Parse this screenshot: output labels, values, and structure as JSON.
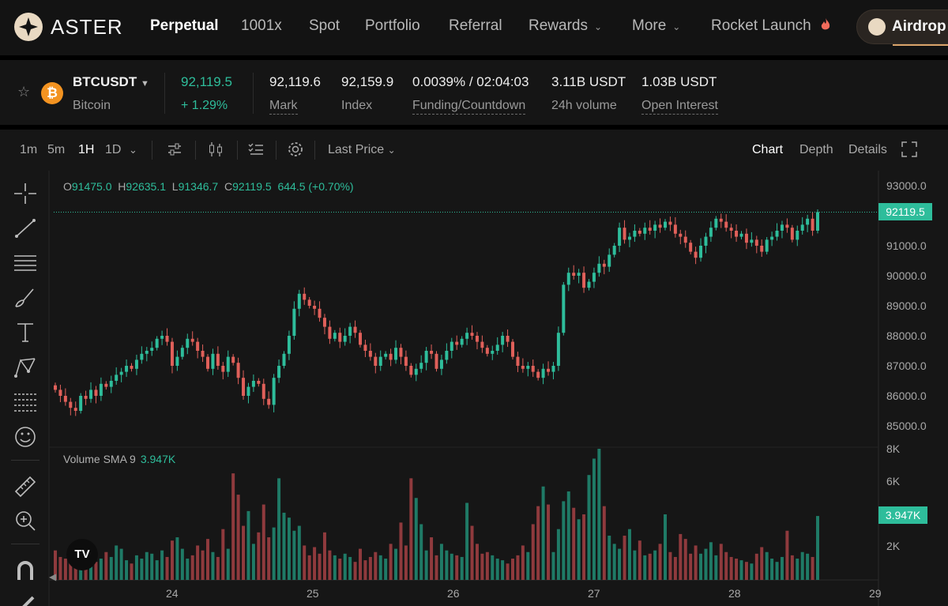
{
  "nav": {
    "brand": "ASTER",
    "items": [
      {
        "label": "Perpetual",
        "active": true
      },
      {
        "label": "1001x"
      },
      {
        "label": "Spot"
      },
      {
        "label": "Portfolio"
      },
      {
        "label": "Referral"
      },
      {
        "label": "Rewards",
        "dropdown": true
      },
      {
        "label": "More",
        "dropdown": true
      },
      {
        "label": "Rocket Launch",
        "icon": "flame-icon"
      }
    ],
    "airdrop": "Airdrop"
  },
  "ticker": {
    "symbol": "BTCUSDT",
    "name": "Bitcoin",
    "last_price": "92,119.5",
    "change": "+ 1.29%",
    "mark": "92,119.6",
    "mark_label": "Mark",
    "index": "92,159.9",
    "index_label": "Index",
    "funding": "0.0039% / 02:04:03",
    "funding_label": "Funding/Countdown",
    "volume": "3.11B USDT",
    "volume_label": "24h volume",
    "open_interest": "1.03B USDT",
    "open_interest_label": "Open Interest"
  },
  "toolbar": {
    "intervals": [
      "1m",
      "5m",
      "1H",
      "1D"
    ],
    "active_interval": "1H",
    "price_type": "Last Price",
    "views": [
      "Chart",
      "Depth",
      "Details"
    ],
    "active_view": "Chart"
  },
  "left_tools": [
    "crosshair-icon",
    "trendline-icon",
    "horizontal-lines-icon",
    "brush-icon",
    "text-icon",
    "pattern-icon",
    "fib-icon",
    "emoji-icon",
    "ruler-icon",
    "zoom-in-icon",
    "magnet-icon",
    "pencil-icon"
  ],
  "ohlc": {
    "o_key": "O",
    "o": "91475.0",
    "h_key": "H",
    "h": "92635.1",
    "l_key": "L",
    "l": "91346.7",
    "c_key": "C",
    "c": "92119.5",
    "chg": "644.5 (+0.70%)"
  },
  "volume_indicator": {
    "label": "Volume SMA 9",
    "value": "3.947K"
  },
  "price_axis": [
    "93000.0",
    "92000.0",
    "91000.0",
    "90000.0",
    "89000.0",
    "88000.0",
    "87000.0",
    "86000.0",
    "85000.0"
  ],
  "volume_axis": [
    "8K",
    "6K",
    "4K",
    "2K"
  ],
  "current_price_tag": "92119.5",
  "volume_tag": "3.947K",
  "time_axis": [
    "24",
    "25",
    "26",
    "27",
    "28",
    "29"
  ],
  "colors": {
    "up": "#2ebd9b",
    "down": "#e0605a",
    "up_vol": "#1f7a66",
    "down_vol": "#8f3a3d"
  },
  "chart_data": {
    "type": "candlestick",
    "interval": "1H",
    "ylim": [
      84500,
      93500
    ],
    "closes": [
      86200,
      86000,
      85800,
      85600,
      85500,
      86000,
      85900,
      86200,
      86000,
      86400,
      86300,
      86500,
      86700,
      86800,
      87000,
      86900,
      87200,
      87400,
      87500,
      87600,
      87900,
      88000,
      87800,
      87000,
      87300,
      87600,
      87900,
      87800,
      87500,
      87300,
      86900,
      87400,
      87000,
      86800,
      87300,
      87100,
      86600,
      86000,
      86300,
      86500,
      86400,
      85900,
      85700,
      86600,
      87000,
      87400,
      88000,
      88900,
      89400,
      89200,
      89000,
      88900,
      88600,
      88300,
      87900,
      88100,
      87800,
      88000,
      88300,
      88100,
      87700,
      87500,
      87300,
      87000,
      87300,
      87400,
      87200,
      87600,
      87300,
      87000,
      86700,
      86900,
      87100,
      87500,
      87400,
      86900,
      87200,
      87500,
      87800,
      87700,
      87900,
      88100,
      88000,
      87800,
      87600,
      87400,
      87500,
      87700,
      88000,
      87800,
      87300,
      87000,
      86900,
      87000,
      86800,
      86600,
      86900,
      86800,
      87000,
      88100,
      89700,
      90100,
      90000,
      90100,
      89600,
      89800,
      90100,
      90400,
      90300,
      90700,
      91000,
      91600,
      91200,
      91300,
      91500,
      91400,
      91600,
      91500,
      91700,
      91600,
      91800,
      91700,
      91400,
      91300,
      91100,
      90800,
      90600,
      91000,
      91300,
      91600,
      91900,
      91800,
      91600,
      91500,
      91300,
      91400,
      91100,
      91200,
      91000,
      90800,
      91200,
      91300,
      91500,
      91700,
      91600,
      91200,
      91500,
      91700,
      91900,
      91500,
      92119.5
    ],
    "volume_range": [
      0,
      8000
    ],
    "volumes": [
      1800,
      1400,
      1300,
      1500,
      1200,
      1000,
      1600,
      1500,
      1100,
      1300,
      1700,
      1400,
      2100,
      1900,
      1200,
      1000,
      1500,
      1300,
      1700,
      1600,
      1200,
      1800,
      1400,
      2400,
      2600,
      1900,
      1300,
      1500,
      2100,
      1800,
      2500,
      1700,
      1400,
      3100,
      1900,
      6500,
      5200,
      3300,
      4200,
      2200,
      2900,
      4600,
      2600,
      3200,
      6200,
      4100,
      3800,
      3000,
      3300,
      2100,
      1500,
      2000,
      1600,
      2900,
      1800,
      1500,
      1300,
      1600,
      1400,
      1100,
      1900,
      1200,
      1400,
      1700,
      1500,
      1300,
      2200,
      1900,
      3500,
      2100,
      6200,
      5000,
      3400,
      1800,
      2600,
      1500,
      2200,
      1800,
      1600,
      1500,
      1400,
      4700,
      3300,
      2200,
      1600,
      1700,
      1500,
      1300,
      1200,
      1000,
      1300,
      1500,
      2100,
      1700,
      3400,
      4500,
      5700,
      4600,
      1700,
      3100,
      4800,
      5400,
      4400,
      3700,
      4000,
      6400,
      7400,
      8000,
      4500,
      2700,
      2200,
      1900,
      2700,
      3100,
      1800,
      2400,
      1500,
      1600,
      1800,
      2200,
      4000,
      1700,
      1400,
      2800,
      2500,
      1600,
      2100,
      1600,
      1900,
      2300,
      1500,
      2200,
      1700,
      1400,
      1300,
      1200,
      1100,
      1000,
      1600,
      2000,
      1700,
      1300,
      1100,
      1400,
      3000,
      1500,
      1300,
      1700,
      1600,
      1400,
      3900
    ]
  }
}
